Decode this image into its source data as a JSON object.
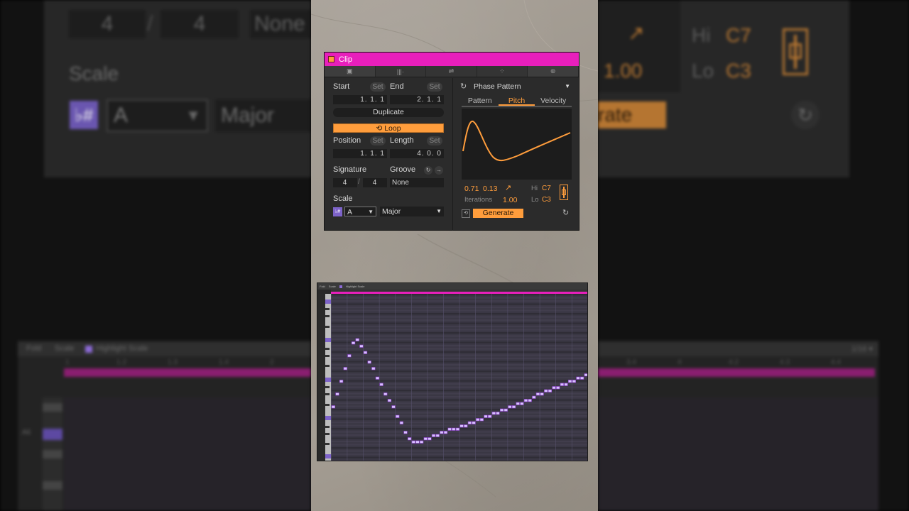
{
  "bg": {
    "numerator": "4",
    "denominator": "4",
    "groove": "None",
    "scale_label": "Scale",
    "scale_key": "A",
    "scale_mode": "Major",
    "arrow": "↗",
    "hi_label": "Hi",
    "hi_value": "C7",
    "lo_label": "Lo",
    "lo_value": "C3",
    "iterations_value": "1.00",
    "generate_partial": "rate",
    "roll_fold": "Fold",
    "roll_scale": "Scale",
    "roll_highlight": "Highlight Scale",
    "roll_grid": "1/16 ▾",
    "roll_note_label": "A6",
    "ruler": [
      "1",
      "1.2",
      "1.3",
      "1.4",
      "2",
      "3.4",
      "4",
      "4.2",
      "4.3",
      "4.4"
    ]
  },
  "clip": {
    "title": "Clip",
    "start_label": "Start",
    "end_label": "End",
    "set": "Set",
    "start_value": "1.   1.   1",
    "end_value": "2.   1.   1",
    "duplicate": "Duplicate",
    "loop": "Loop",
    "position_label": "Position",
    "length_label": "Length",
    "position_value": "1.   1.   1",
    "length_value": "4.   0.   0",
    "signature_label": "Signature",
    "groove_label": "Groove",
    "sig_num": "4",
    "sig_den": "4",
    "groove_value": "None",
    "scale_label": "Scale",
    "scale_key": "A",
    "scale_mode": "Major",
    "generator": "Phase Pattern",
    "tabs": [
      "Pattern",
      "Pitch",
      "Velocity"
    ],
    "val1": "0.71",
    "val2": "0.13",
    "iterations_label": "Iterations",
    "iterations_value": "1.00",
    "hi_label": "Hi",
    "hi_value": "C7",
    "lo_label": "Lo",
    "lo_value": "C3",
    "generate": "Generate"
  },
  "colors": {
    "accent": "#ff9d3c",
    "clip_color": "#e81fbc",
    "note_color": "#c39cff"
  }
}
